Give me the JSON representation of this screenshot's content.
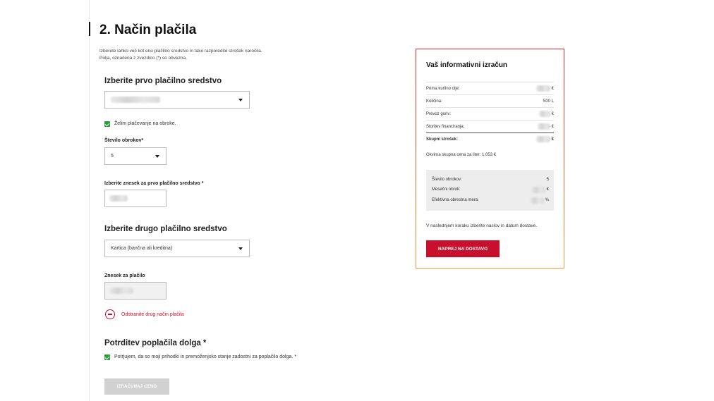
{
  "title": "2. Način plačila",
  "intro": {
    "line1": "Izberete lahko več kot eno plačilno sredstvo in tako razporedite strošek naročila.",
    "line2": "Polja, označena z zvezdico (*) so obvezna."
  },
  "first_payment": {
    "heading": "Izberite prvo plačilno sredstvo",
    "installments_checkbox_label": "Želim plačevanje na obroke.",
    "installments_checked": true,
    "installments_label": "Število obrokov*",
    "installments_value": "5",
    "amount_label": "Izberite znesek za prvo plačilno sredstvo *"
  },
  "second_payment": {
    "heading": "Izberite drugo plačilno sredstvo",
    "selected": "Kartica (bančna ali kreditna)",
    "amount_label": "Znesek za plačilo",
    "remove_label": "Odstranite drug način plačila"
  },
  "confirm": {
    "heading": "Potrditev poplačila dolga *",
    "checkbox_label": "Potrjujem, da so moji prihodki in premoženjsko stanje zadostni za poplačilo dolga. *",
    "checked": true
  },
  "calc_button": "IZRAČUNAJ CENO",
  "summary": {
    "title": "Vaš informativni izračun",
    "rows": [
      {
        "label": "Prima kurilno olje:",
        "value": "",
        "unit": "€"
      },
      {
        "label": "Količina:",
        "value": "500 L",
        "unit": ""
      },
      {
        "label": "Prevoz goriv:",
        "value": "",
        "unit": "€"
      },
      {
        "label": "Storitev financiranja:",
        "value": "",
        "unit": "€"
      },
      {
        "label": "Skupni strošek:",
        "value": "",
        "unit": "€"
      }
    ],
    "note": "Okvirna skupna cena za liter: 1,053 €",
    "installments": [
      {
        "label": "Število obrokov:",
        "value": "5",
        "unit": ""
      },
      {
        "label": "Mesečni obrok:",
        "value": "",
        "unit": "€"
      },
      {
        "label": "Efektivna obrestna mera:",
        "value": "",
        "unit": "%"
      }
    ],
    "next_note": "V naslednjem koraku izberite naslov in datum dostave.",
    "next_button": "NAPREJ NA DOSTAVO"
  }
}
